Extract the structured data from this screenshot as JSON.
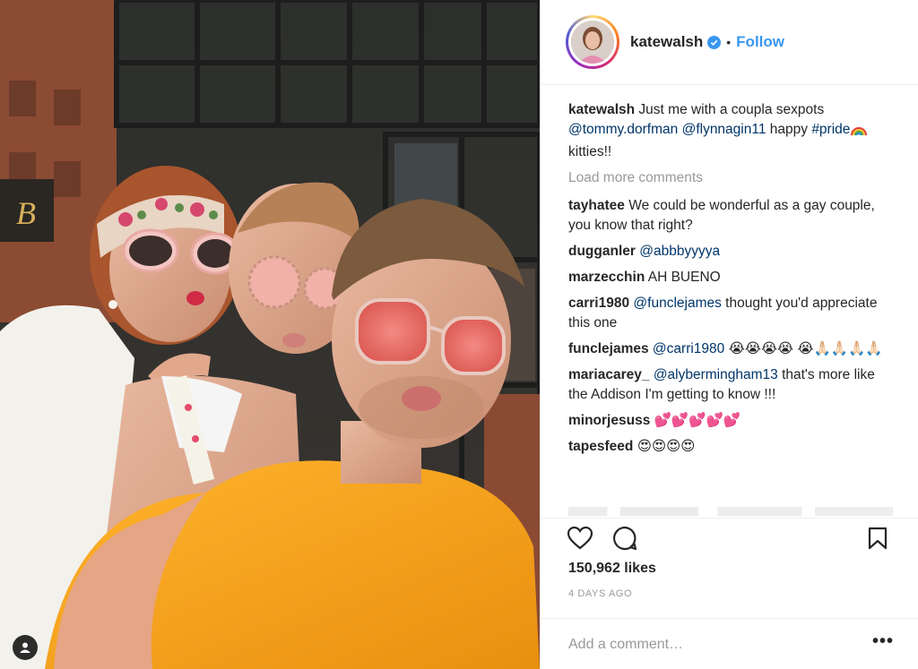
{
  "post": {
    "username": "katewalsh",
    "follow_label": "Follow",
    "separator": "•",
    "caption": {
      "user": "katewalsh",
      "text_1": "Just me with a coupla sexpots",
      "mention_1": "@tommy.dorfman",
      "mention_2": "@flynnagin11",
      "text_2": "happy",
      "hashtag": "#pride",
      "text_3": "kitties!!"
    },
    "load_more": "Load more comments",
    "comments": [
      {
        "user": "tayhatee",
        "text": "We could be wonderful as a gay couple, you know that right?"
      },
      {
        "user": "dugganler",
        "mention": "@abbbyyyya"
      },
      {
        "user": "marzecchin",
        "text": "AH BUENO"
      },
      {
        "user": "carri1980",
        "mention": "@funclejames",
        "text": "thought you'd appreciate this one"
      },
      {
        "user": "funclejames",
        "mention": "@carri1980",
        "emoji": "😭😭😭😭 😭🙏🏻🙏🏻🙏🏻🙏🏻"
      },
      {
        "user": "mariacarey_",
        "mention": "@alybermingham13",
        "text": "that's more like the Addison I'm getting to know !!!"
      },
      {
        "user": "minorjesuss",
        "emoji": "💕💕💕💕💕"
      },
      {
        "user": "tapesfeed",
        "emoji": "😍😍😍😍"
      }
    ],
    "likes": "150,962 likes",
    "age": "4 DAYS AGO",
    "comment_placeholder": "Add a comment…",
    "more_options": "•••"
  },
  "icons": {
    "verified": "verified-check-icon",
    "like": "heart-icon",
    "comment": "comment-bubble-icon",
    "save": "bookmark-icon",
    "tagged": "user-tag-icon"
  },
  "colors": {
    "accent": "#3897f0",
    "mention": "#003569",
    "muted": "#999999",
    "text": "#262626",
    "tank_top": "#f5a623"
  }
}
